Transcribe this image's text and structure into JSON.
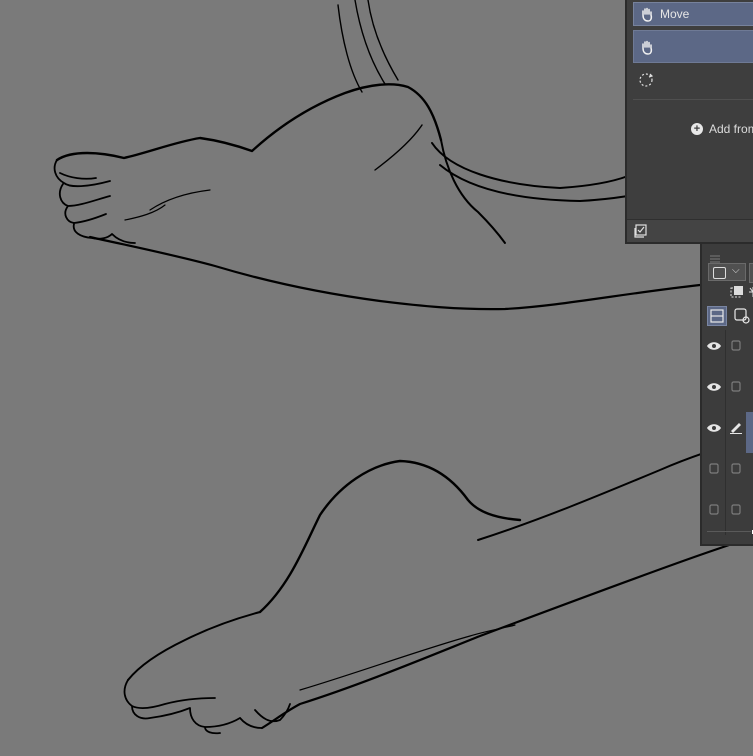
{
  "subtool_panel": {
    "items": [
      {
        "label": "Move",
        "icon": "hand-icon",
        "selected": true
      },
      {
        "label": "",
        "icon": "hand-icon",
        "selected": true
      },
      {
        "label": "",
        "icon": "rotate-icon",
        "selected": false
      }
    ],
    "add_from_label": "Add from",
    "footer_icon": "settings-check-icon"
  },
  "layer_panel": {
    "blend_mode_icon": "square-swatch",
    "layers": [
      {
        "visible": true,
        "icon": "eye-icon",
        "status_icon": "lock-box-icon",
        "selected": false
      },
      {
        "visible": true,
        "icon": "eye-icon",
        "status_icon": "lock-box-icon",
        "selected": false
      },
      {
        "visible": true,
        "icon": "eye-icon",
        "status_icon": "pen-icon",
        "selected": true
      },
      {
        "visible": false,
        "icon": "empty-box-icon",
        "status_icon": "lock-box-icon",
        "selected": false
      },
      {
        "visible": false,
        "icon": "empty-box-icon",
        "status_icon": "lock-box-icon",
        "selected": false
      }
    ]
  },
  "colors": {
    "canvas": "#7a7a7a",
    "panel": "#3e3e3e",
    "selection": "#5c6886",
    "line_art": "#000000"
  }
}
